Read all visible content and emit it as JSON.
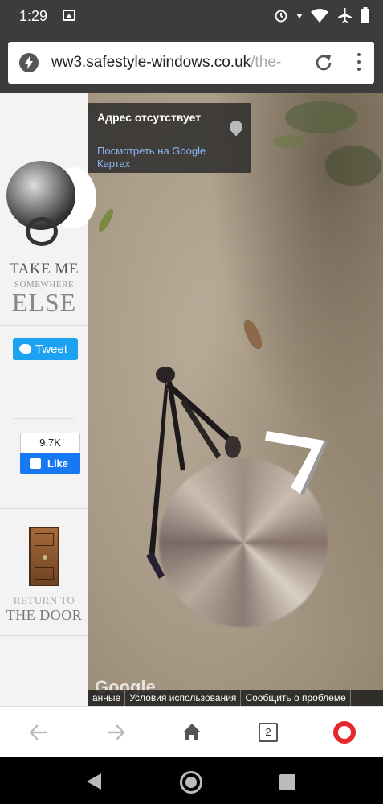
{
  "status_bar": {
    "time": "1:29",
    "icons": [
      "image-icon",
      "alarm-icon",
      "wifi-icon",
      "airplane-icon",
      "battery-icon"
    ]
  },
  "url_bar": {
    "url_host": "ww3.safestyle-windows.co.uk",
    "url_rest": "/the-",
    "icons": [
      "amp-bolt-icon",
      "reload-icon",
      "menu-dots-icon"
    ]
  },
  "sidebar": {
    "take_me_1": "TAKE ME",
    "take_me_2": "SOMEWHERE",
    "take_me_3": "ELSE",
    "tweet_label": "Tweet",
    "like_count": "9.7K",
    "like_label": "Like",
    "return_1": "RETURN TO",
    "return_2": "THE DOOR"
  },
  "map": {
    "address": "Адрес отсутствует",
    "view_link": "Посмотреть на Google Картах",
    "google_logo": "Google",
    "footer_items": [
      "анные",
      "Условия использования",
      "Сообщить о проблеме"
    ]
  },
  "browser_bar": {
    "tab_count": "2",
    "icons": [
      "back-arrow-icon",
      "forward-arrow-icon",
      "home-icon",
      "tabs-icon",
      "opera-icon"
    ]
  },
  "colors": {
    "status_bg": "#3c3c3c",
    "tweet_blue": "#1da1f2",
    "facebook_blue": "#1877f2",
    "opera_red": "#e4282c",
    "link_blue": "#8ab4f8"
  }
}
